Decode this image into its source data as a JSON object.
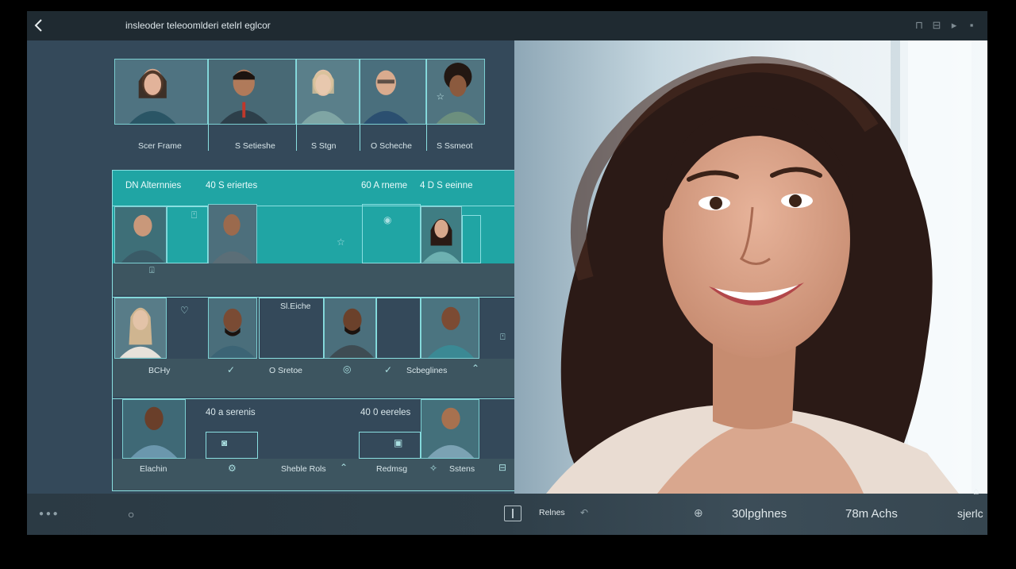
{
  "header": {
    "back_icon": "chevron-left-icon",
    "title": "insleoder teleoomlderi etelrl eglcor",
    "icons": [
      "pin-icon",
      "window-icon",
      "play-icon",
      "stop-icon"
    ]
  },
  "top_participants": {
    "names": [
      "Scer Frame",
      "S Setieshe",
      "S Stgn",
      "O Scheche",
      "S Ssmeot"
    ]
  },
  "grid": {
    "header_left_1": "DN Alternnies",
    "header_left_2": "40 S eriertes",
    "header_right_1": "60 A rneme",
    "header_right_2": "4 D S eeinne",
    "row2_label": "Sl.Eiche",
    "row2_caption_1": "BCHy",
    "row2_caption_2": "O Sretoe",
    "row2_caption_3": "Scbeglines",
    "row3_label_1": "40 a serenis",
    "row3_label_2": "40 0 eereles",
    "row3_caption_1": "Elachin",
    "row3_caption_2": "Sheble Rols",
    "row3_caption_3": "Redmsg",
    "row3_caption_4": "Sstens"
  },
  "footer": {
    "label_left": "Relnes",
    "stat_1": "30lpghnes",
    "stat_2": "78m Achs",
    "stat_3": "sjerlc"
  },
  "colors": {
    "accent": "#20a5a4",
    "frame": "#8adfe1",
    "panel": "#34495a",
    "topbar": "#1f2a31"
  }
}
